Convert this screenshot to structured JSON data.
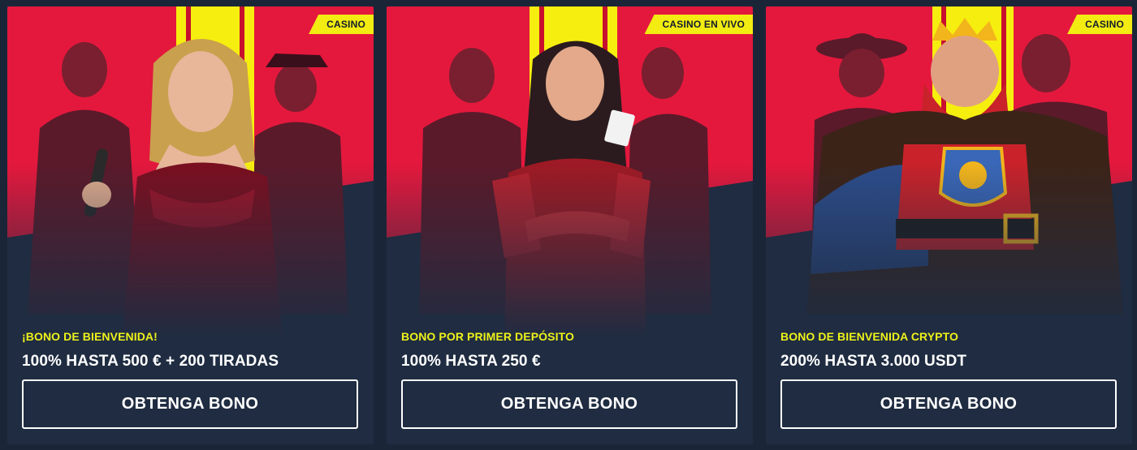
{
  "cards": [
    {
      "tag": "CASINO",
      "subtitle": "¡BONO DE BIENVENIDA!",
      "headline": "100% HASTA 500 € + 200 TIRADAS",
      "button_label": "OBTENGA BONO"
    },
    {
      "tag": "CASINO EN VIVO",
      "subtitle": "BONO POR PRIMER DEPÓSITO",
      "headline": "100% HASTA 250 €",
      "button_label": "OBTENGA BONO"
    },
    {
      "tag": "CASINO",
      "subtitle": "BONO DE BIENVENIDA CRYPTO",
      "headline": "200% HASTA 3.000 USDT",
      "button_label": "OBTENGA BONO"
    }
  ],
  "colors": {
    "page_background": "#1a2638",
    "card_background": "#1f2c41",
    "accent_yellow": "#f2ec12",
    "banner_red": "#e4183d"
  }
}
